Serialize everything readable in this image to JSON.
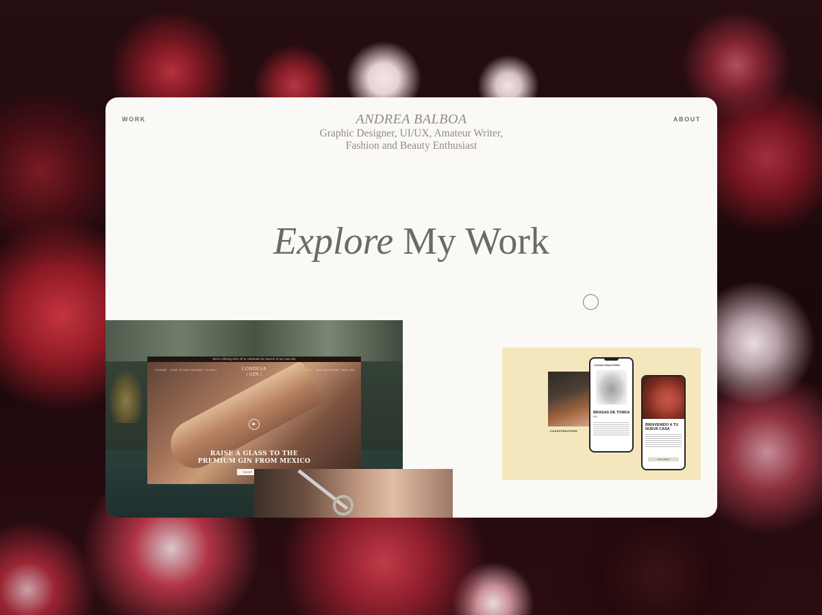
{
  "nav": {
    "work_label": "WORK",
    "about_label": "ABOUT"
  },
  "brand": {
    "name": "ANDREA BALBOA",
    "tagline_line1": "Graphic Designer, UI/UX, Amateur Writer,",
    "tagline_line2": "Fashion and Beauty Enthusiast"
  },
  "hero": {
    "headline_italic": "Explore",
    "headline_rest": "My Work"
  },
  "projects": {
    "gin": {
      "banner": "We're offering 20% off to celebrate the launch of our new site",
      "nav_left": [
        "STORE",
        "OUR STORY",
        "WHERE TO BUY"
      ],
      "nav_right": [
        "CONTACT",
        "MY ACCOUNT",
        "BAG (0)"
      ],
      "logo_line1": "CONDESA",
      "logo_line2": "| GIN |",
      "headline_line1": "RAISE A GLASS TO THE",
      "headline_line2": "PREMIUM GIN FROM MEXICO",
      "cta": "SHOP"
    },
    "casa": {
      "brand": "CASAFORASTERS",
      "label": "CASAFORASTERS",
      "product_title": "BRASAS DE TONKA",
      "product_sub": "€95",
      "screen2_title_line1": "BIENVENIDO A TU",
      "screen2_title_line2": "NUEVA CASA",
      "screen2_button": "DESCUBRIR"
    }
  },
  "colors": {
    "card_bg": "#fbf9f5",
    "text_grey": "#6c6a67",
    "casa_bg": "#f4e7bd"
  }
}
